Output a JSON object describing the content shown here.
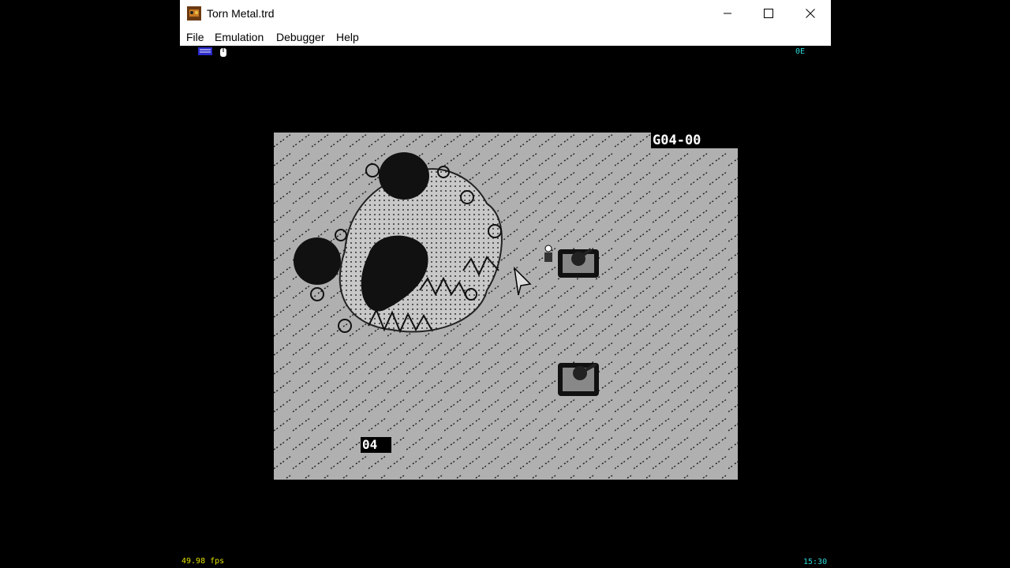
{
  "window": {
    "title": "Torn Metal.trd",
    "app_icon": "joystick-app-icon"
  },
  "controls": {
    "minimize": "minimize-icon",
    "maximize": "maximize-icon",
    "close": "close-icon"
  },
  "menu": [
    "File",
    "Emulation",
    "Debugger",
    "Help"
  ],
  "status": {
    "fps": "49.98 fps",
    "clock": "15:30",
    "code": "0E"
  },
  "game": {
    "score": "G04-00",
    "counter": "04"
  },
  "colors": {
    "screen_bg": "#b0b0b0",
    "pattern": "#202020",
    "hud_text": "#ffffff",
    "status_cyan": "#2bd9d9",
    "indicator_blue": "#3a3aff"
  }
}
